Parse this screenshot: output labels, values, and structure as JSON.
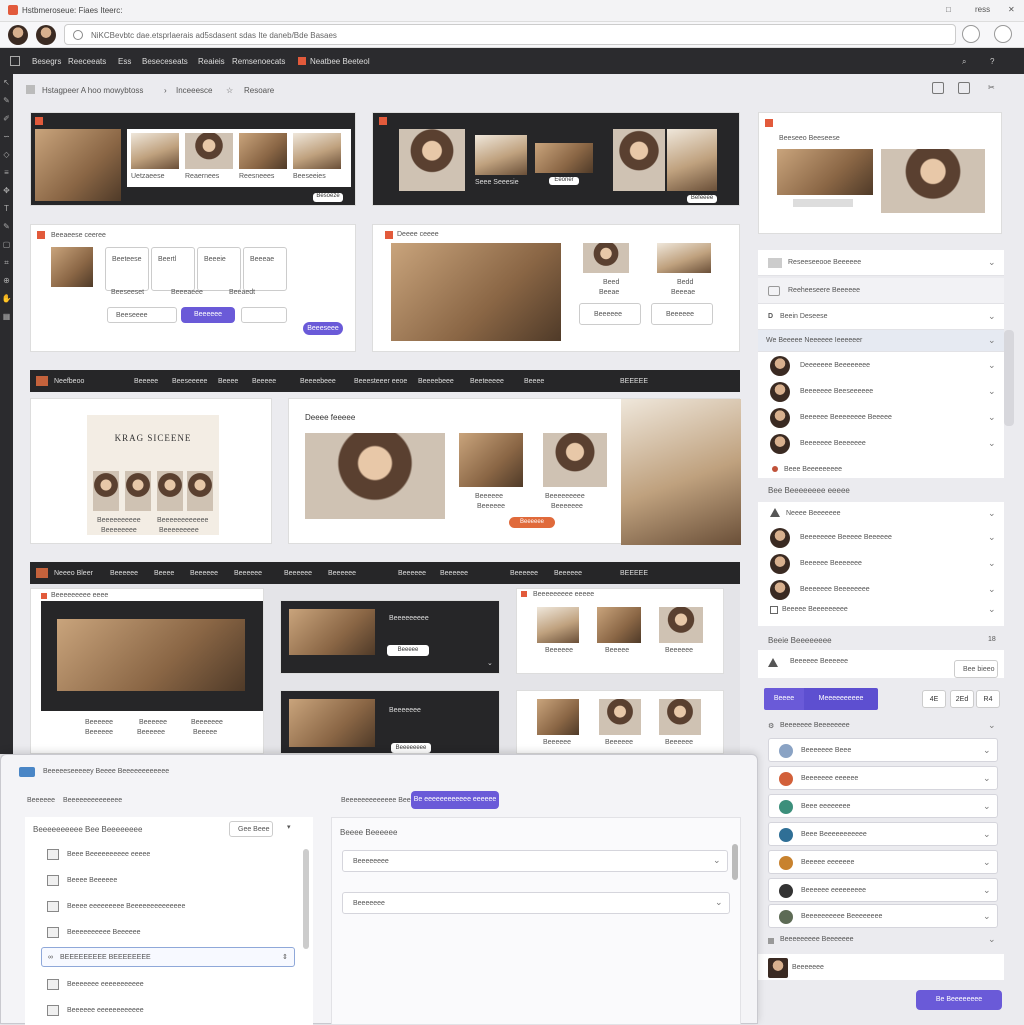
{
  "window": {
    "title": "Hstbmeroseue: Fiaes Iteerc:",
    "controls": [
      "□",
      "ress",
      "✕"
    ]
  },
  "address": {
    "url": "NiKCBevbtc dae.etsprlaerais ad5sdasent sdas Ite daneb/Bde Basaes"
  },
  "menu": [
    "Besegrs",
    "Reeceeats",
    "Ess",
    "Beseceseats",
    "Reaieis",
    "Remsenoecats",
    "Neatbee Beeteol"
  ],
  "toolbar": {
    "title": "Hstagpeer A hoo mowybtoss",
    "tab": "Inceeesce",
    "tab2": "Resoare"
  },
  "card1": {
    "items": [
      "Uetzaeese",
      "Reaernees",
      "Reesneees",
      "Beeseeies"
    ],
    "footer": "Besoeze"
  },
  "card2": {
    "label": "Seee Seeesie",
    "btn": "Eeoner",
    "footer": "Befeeee"
  },
  "card3": {
    "label": "Beeseeo Beeseese"
  },
  "card4": {
    "title": "Beeaeese ceeree",
    "tiles": [
      "Beeteese",
      "Beertl",
      "Beeeie",
      "Beeeae"
    ],
    "tiles2": [
      "Beeseeset",
      "Beeeaeee",
      "Beeaedt"
    ],
    "btn1": "Beeseeee",
    "btn2": "Beeeeee",
    "btn3": "Beeeseee"
  },
  "card5": {
    "title": "Deeee ceeee",
    "cap1": "Beed",
    "cap1b": "Beeae",
    "cap2": "Bedd",
    "cap2b": "Beeeae",
    "btn1": "Beeeeee",
    "btn2": "Beeeeee"
  },
  "card6": {
    "title": "Beeeeseee"
  },
  "band1": {
    "brand": "Neefbeoo",
    "items": [
      "Beeeee",
      "Beeseeeee",
      "Beeee",
      "Beeeee",
      "Beeeebeee",
      "Beeesteeer eeoe",
      "Beeeebeee",
      "Beeteeeee",
      "Beeee",
      "BEEEEE"
    ]
  },
  "sec2a": {
    "headline": "KRAG SICEENE",
    "cap1": "Beeeeeeeeee",
    "cap2": "Beeeeeeeeeeee",
    "cap3": "Beeeeeeee",
    "cap4": "Beeeeeeeee"
  },
  "sec2b": {
    "title": "Deeee feeeee",
    "cap1": "Beeeeee",
    "cap1b": "Beeeeee",
    "cap2": "Beeeeeeeee",
    "cap2b": "Beeeeeee",
    "btn": "Beeeeee"
  },
  "band2": {
    "brand": "Neeeo Bleer",
    "items": [
      "Beeeeee",
      "Beeee",
      "Beeeeee",
      "Beeeeee",
      "Beeeeee",
      "Beeeeee",
      "Beeeeee",
      "Beeeeee",
      "Beeeeee",
      "Beeeeee",
      "BEEEEE"
    ]
  },
  "sec3a": {
    "title": "Beeeeeeeee eeee",
    "cap1": "Beeeeee",
    "cap1b": "Beeeeee",
    "cap2": "Beeeeee",
    "cap2b": "Beeeeee",
    "cap3": "Beeeeeee",
    "cap3b": "Beeeee"
  },
  "sec3b": {
    "title": "Beeeeeeeee",
    "btn": "Beeeee",
    "title2": "Beeeeeee",
    "btn2": "Beeeeeeee"
  },
  "sec3c": {
    "title": "Beeeeeeeee eeeee",
    "c": [
      "Beeeeee",
      "Beeeee",
      "Beeeeee",
      "Beeeeee",
      "Beeeeee",
      "Beeeeee"
    ]
  },
  "right": {
    "r1": "Reseeseeooe Beeeeee",
    "r2": "Reeheeseere Beeeeee",
    "r3": "Beein Deseese",
    "r4": "We Beeeee Neeeeee Ieeeeeer",
    "people": [
      "Deeeeeee Beeeeeeee",
      "Beeeeeee Beeseeeeee",
      "Beeeeee Beeeeeeee Beeeee",
      "Beeeeeee Beeeeeee",
      "Beee Beeeeeeeee"
    ],
    "s2": "Bee Beeeeeeee eeeee",
    "r5": "Neeee Beeeeeee",
    "people2": [
      "Beeeeeeee Beeeee Beeeeee",
      "Beeeeee Beeeeeee",
      "Beeeeeee Beeeeeeee",
      "Beeeee Beeeeeeeee"
    ],
    "s3": "Beeie Beeeeeeee",
    "s3n": "18",
    "r6": "Beeeeee Beeeeee",
    "b1": "Bee bieeo",
    "tabA": "Beeee",
    "tabB": "Meeeeeeeeee",
    "n1": "4E",
    "n2": "2Ed",
    "n3": "R4",
    "s4": "Beeeeeee Beeeeeeee",
    "list": [
      "Beeeeeee Beee",
      "Beeeeeee eeeeee",
      "Beee eeeeeeee",
      "Beee Beeeeeeeeeee",
      "Beeeee eeeeeee",
      "Beeeeee eeeeeeeee",
      "Beeeeeeeeee Beeeeeeee"
    ],
    "s5": "Beeeeeeeee Beeeeeee",
    "s5v": "Beeeeeee",
    "action": "Be Beeeeeeee"
  },
  "dialog": {
    "title": "Beeeeeseeeeey Beeee Beeeeeeeeeeee",
    "tab1": "Beeeeee",
    "tab2": "Beeeeeeeeeeeeee",
    "rtab1": "Beeeeeeeeeeeee Bee",
    "rtab2": "Be eeeeeeeeeeee eeeeee",
    "left_title": "Beeeeeeeeee Bee Beeeeeeee",
    "pill": "Gee Beee",
    "items": [
      "Beee Beeeeeeeeee eeeee",
      "Beeee Beeeeee",
      "Beeee eeeeeeeee Beeeeeeeeeeeeee",
      "Beeeeeeeeee Beeeeee",
      "BEEEEEEEEE BEEEEEEEE",
      "Beeeeeee eeeeeeeeeee",
      "Beeeeee eeeeeeeeeeee"
    ],
    "right_title": "Beeee Beeeeee",
    "sel1": "Beeeeeeee",
    "sel2": "Beeeeeee"
  }
}
